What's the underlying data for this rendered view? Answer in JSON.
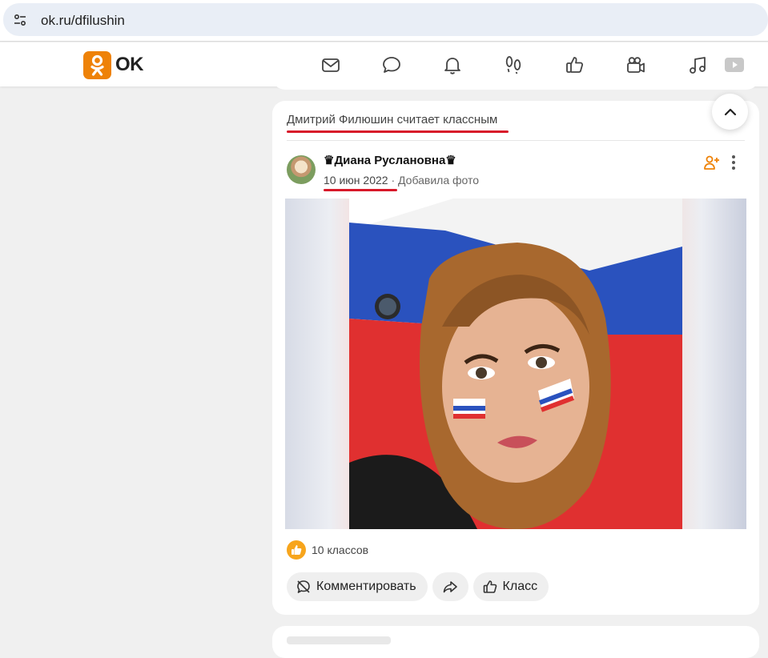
{
  "browser": {
    "url": "ok.ru/dfilushin"
  },
  "header": {
    "logo_text": "OK",
    "brand_color": "#ee8208",
    "nav_icons": [
      "mail-icon",
      "chat-icon",
      "bell-icon",
      "footprints-icon",
      "like-icon",
      "video-camera-icon",
      "music-icon",
      "video-icon"
    ]
  },
  "post": {
    "reason": "Дмитрий Филюшин считает классным",
    "author": "♛Диана Руслановна♛",
    "date": "10 июн 2022",
    "separator": "·",
    "action": "Добавила фото",
    "likes_text": "10 классов",
    "buttons": {
      "comment": "Комментировать",
      "like": "Класс"
    }
  },
  "colors": {
    "underline": "#d8192a",
    "like_badge": "#f7a51c"
  }
}
